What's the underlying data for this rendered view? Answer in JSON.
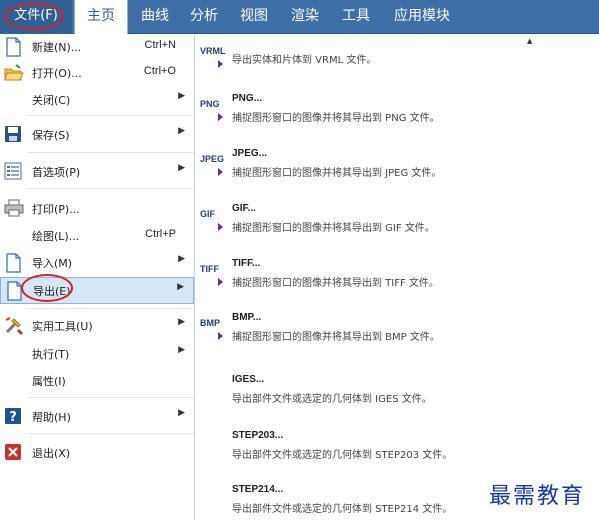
{
  "ribbon": {
    "file_tab": "文件(F)",
    "tabs": [
      "主页",
      "曲线",
      "分析",
      "视图",
      "渲染",
      "工具",
      "应用模块"
    ]
  },
  "menu": {
    "items": [
      {
        "label": "新建(N)...",
        "shortcut": "Ctrl+N",
        "icon": "new-file-icon"
      },
      {
        "label": "打开(O)...",
        "shortcut": "Ctrl+O",
        "icon": "open-folder-icon"
      },
      {
        "label": "关闭(C)",
        "arrow": "▶",
        "icon": ""
      },
      {
        "label": "保存(S)",
        "arrow": "▶",
        "icon": "save-disk-icon"
      },
      {
        "label": "首选项(P)",
        "arrow": "▶",
        "icon": "preferences-list-icon"
      },
      {
        "label": "打印(P)...",
        "icon": "printer-icon"
      },
      {
        "label": "绘图(L)...",
        "shortcut": "Ctrl+P",
        "icon": ""
      },
      {
        "label": "导入(M)",
        "arrow": "▶",
        "icon": "import-icon"
      },
      {
        "label": "导出(E)",
        "arrow": "▶",
        "icon": "export-icon"
      },
      {
        "label": "实用工具(U)",
        "arrow": "▶",
        "icon": "tools-icon"
      },
      {
        "label": "执行(T)",
        "arrow": "▶",
        "icon": ""
      },
      {
        "label": "属性(I)",
        "icon": ""
      },
      {
        "label": "帮助(H)",
        "arrow": "▶",
        "icon": "help-icon"
      },
      {
        "label": "退出(X)",
        "icon": "exit-icon"
      }
    ]
  },
  "exports": [
    {
      "format": "VRML",
      "title": "",
      "desc": "导出实体和片体到 VRML 文件。"
    },
    {
      "format": "PNG",
      "title": "PNG...",
      "desc": "捕捉图形窗口的图像并将其导出到 PNG 文件。"
    },
    {
      "format": "JPEG",
      "title": "JPEG...",
      "desc": "捕捉图形窗口的图像并将其导出到 JPEG 文件。"
    },
    {
      "format": "GIF",
      "title": "GIF...",
      "desc": "捕捉图形窗口的图像并将其导出到 GIF 文件。"
    },
    {
      "format": "TIFF",
      "title": "TIFF...",
      "desc": "捕捉图形窗口的图像并将其导出到 TIFF 文件。"
    },
    {
      "format": "BMP",
      "title": "BMP...",
      "desc": "捕捉图形窗口的图像并将其导出到 BMP 文件。"
    },
    {
      "format": "",
      "title": "IGES...",
      "desc": "导出部件文件或选定的几何体到 IGES 文件。"
    },
    {
      "format": "",
      "title": "STEP203...",
      "desc": "导出部件文件或选定的几何体到 STEP203 文件。"
    },
    {
      "format": "",
      "title": "STEP214...",
      "desc": "导出部件文件或选定的几何体到 STEP214 文件。"
    }
  ],
  "scroll_up_glyph": "▲",
  "watermark": "最需教育",
  "colors": {
    "ribbon_blue": "#3d6ea6",
    "highlight": "#d5e6f7",
    "annotation_red": "#d82020",
    "format_label": "#1f3f79"
  }
}
